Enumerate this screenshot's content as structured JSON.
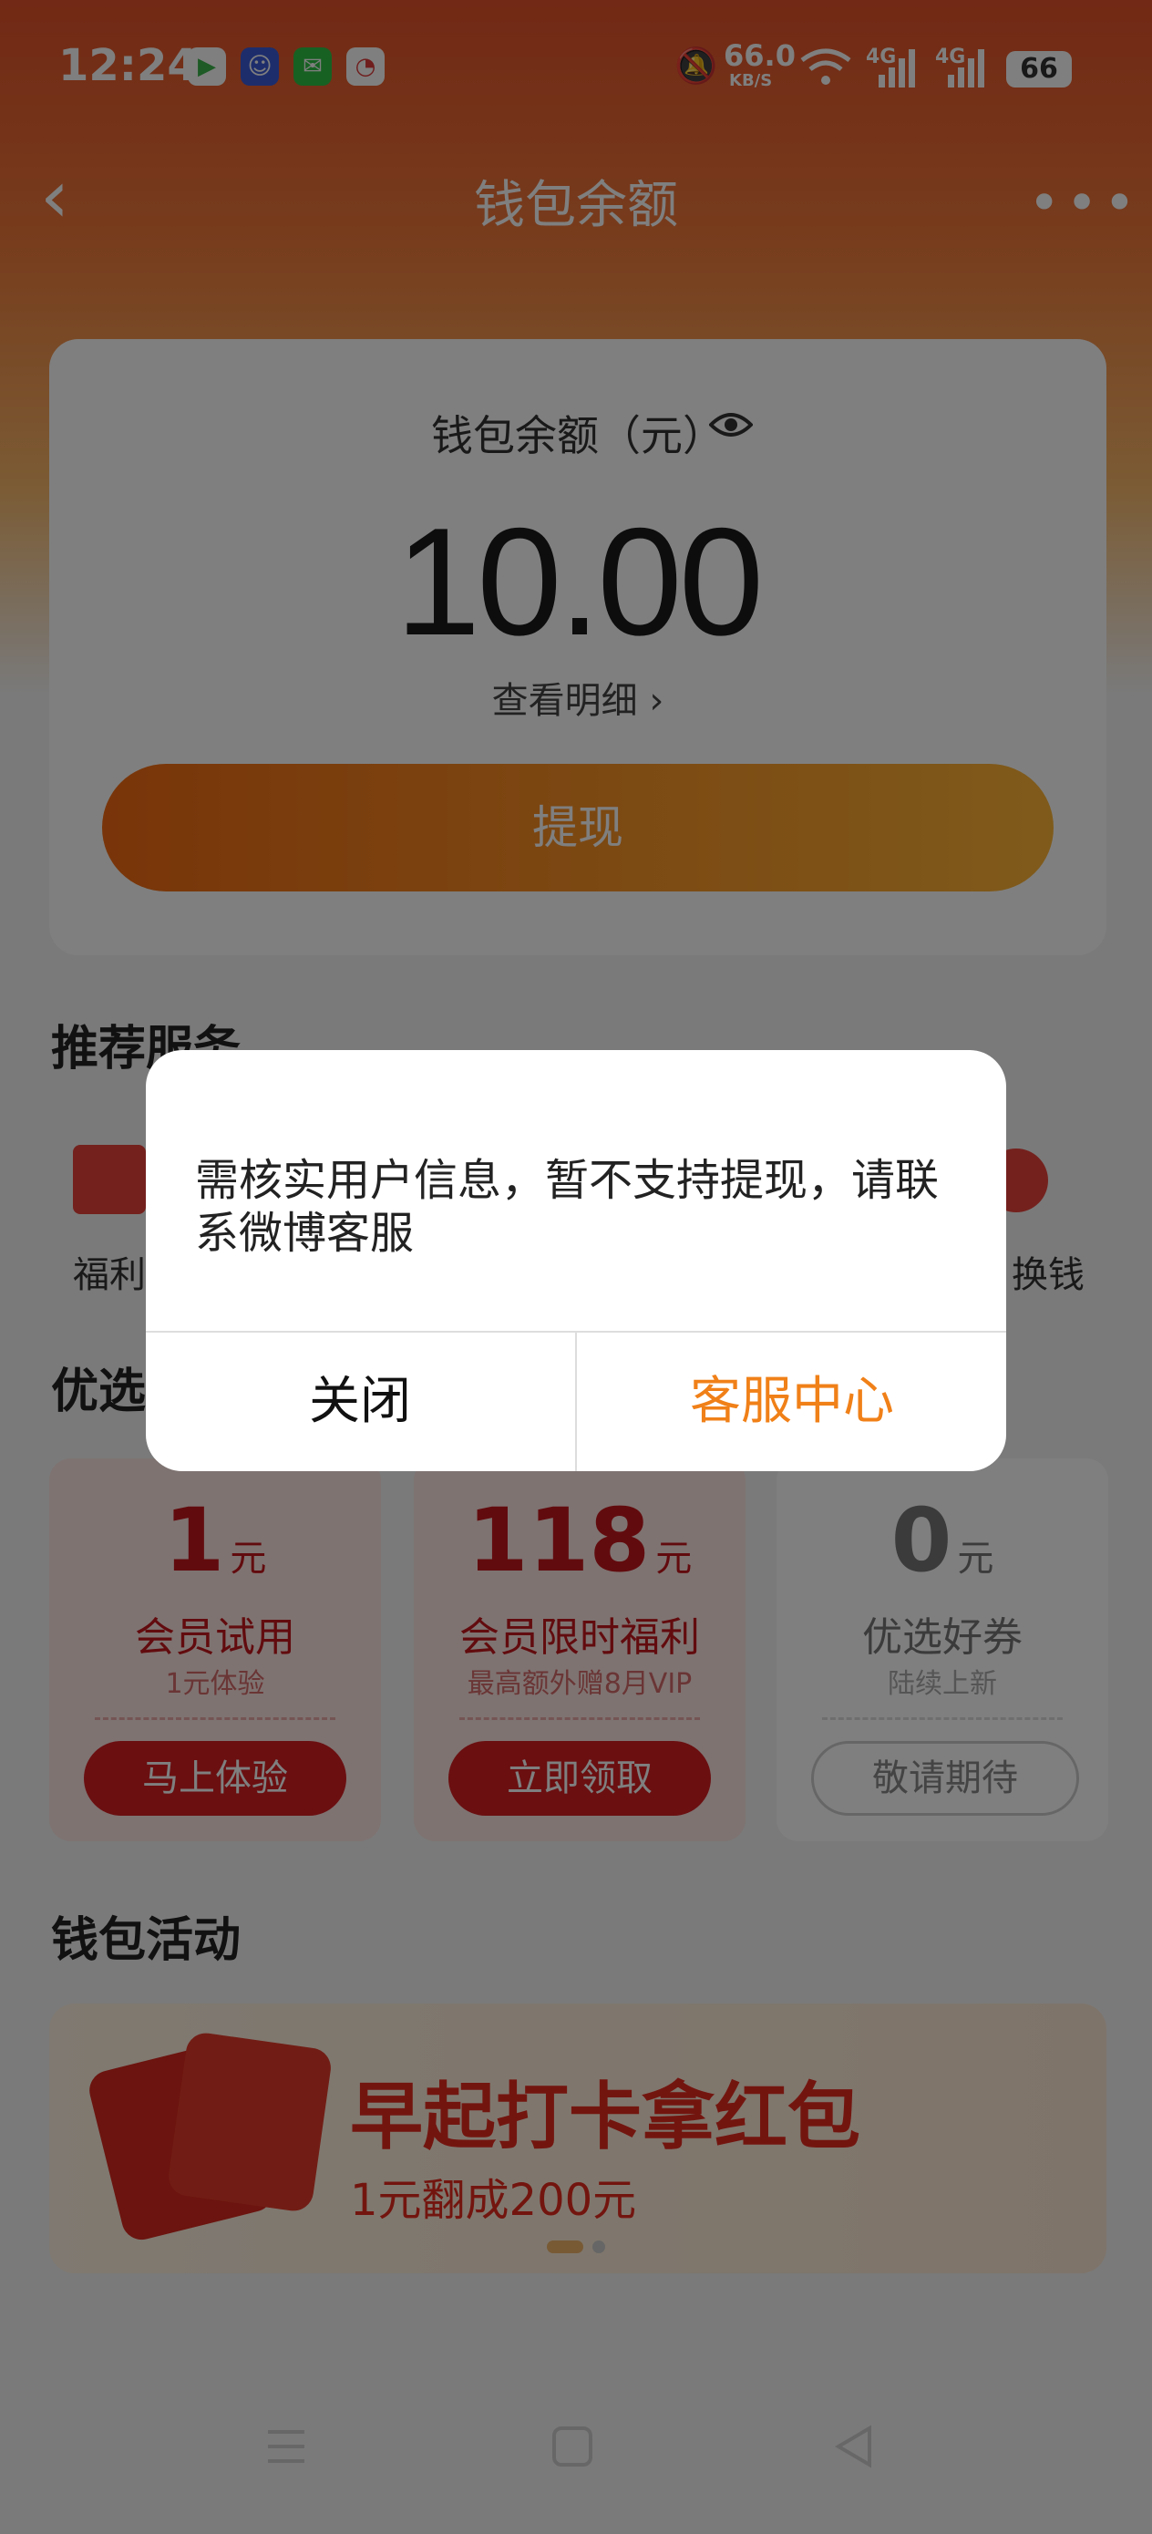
{
  "status_bar": {
    "time": "12:24",
    "net_speed": "66.0",
    "net_unit": "KB/S",
    "signal_1": "4G",
    "signal_2": "4G",
    "battery": "66"
  },
  "nav": {
    "title": "钱包余额"
  },
  "balance": {
    "label": "钱包余额（元）",
    "amount": "10.00",
    "detail_link": "查看明细",
    "withdraw_button": "提现"
  },
  "services": {
    "title": "推荐服务",
    "items": [
      {
        "label": "福利"
      },
      {
        "label": "换钱"
      }
    ]
  },
  "vouchers": {
    "title": "优选",
    "items": [
      {
        "amount": "1",
        "unit": "元",
        "name": "会员试用",
        "sub": "1元体验",
        "button": "马上体验"
      },
      {
        "amount": "118",
        "unit": "元",
        "name": "会员限时福利",
        "sub": "最高额外赠8月VIP",
        "button": "立即领取"
      },
      {
        "amount": "0",
        "unit": "元",
        "name": "优选好券",
        "sub": "陆续上新",
        "button": "敬请期待"
      }
    ]
  },
  "activities": {
    "title": "钱包活动",
    "banner_title": "早起打卡拿红包",
    "banner_subtitle": "1元翻成200元"
  },
  "dialog": {
    "message": "需核实用户信息，暂不支持提现，请联系微博客服",
    "close_button": "关闭",
    "service_button": "客服中心"
  },
  "colors": {
    "accent": "#f08018",
    "brand_red": "#d71f23"
  }
}
